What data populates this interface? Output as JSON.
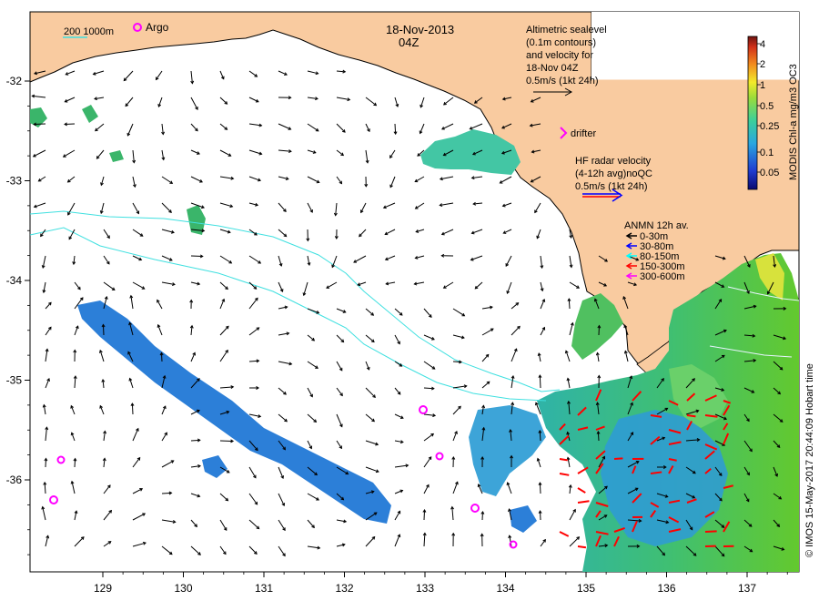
{
  "header": {
    "date": "18-Nov-2013",
    "time": "04Z"
  },
  "legend_top_left": {
    "depth_contours": "200  1000m",
    "argo_label": "Argo"
  },
  "altimetry_note": {
    "lines": [
      "Altimetric sealevel",
      "(0.1m contours)",
      "and velocity for",
      "18-Nov 04Z",
      "0.5m/s (1kt 24h)"
    ]
  },
  "drifter_label": "drifter",
  "hf_radar": {
    "lines": [
      "HF radar velocity",
      "(4-12h avg)noQC",
      "0.5m/s (1kt 24h)"
    ]
  },
  "anmn_legend": {
    "title": "ANMN 12h av.",
    "items": [
      {
        "label": "0-30m",
        "color": "#000000"
      },
      {
        "label": "30-80m",
        "color": "#0000ff"
      },
      {
        "label": "80-150m",
        "color": "#00ffff"
      },
      {
        "label": "150-300m",
        "color": "#ff0000"
      },
      {
        "label": "300-600m",
        "color": "#ff00ff"
      }
    ]
  },
  "colorbar": {
    "title": "MODIS Chl-a mg/m3 OC3",
    "ticks": [
      "4",
      "2",
      "1",
      "0.5",
      "0.25",
      "0.1",
      "0.05"
    ]
  },
  "credit": "© IMOS 15-May-2017 20:44:09 Hobart time",
  "axes": {
    "lon_ticks": [
      "129",
      "130",
      "131",
      "132",
      "133",
      "134",
      "135",
      "136",
      "137"
    ],
    "lat_ticks": [
      "-32",
      "-33",
      "-34",
      "-35",
      "-36"
    ]
  },
  "colors": {
    "land": "#f9cba0",
    "coast": "#000000",
    "isobath": "#40e0e0",
    "argo": "#ff00ff",
    "hf_radar_arrow": "#ff0000",
    "anmn_red": "#ff0000"
  }
}
